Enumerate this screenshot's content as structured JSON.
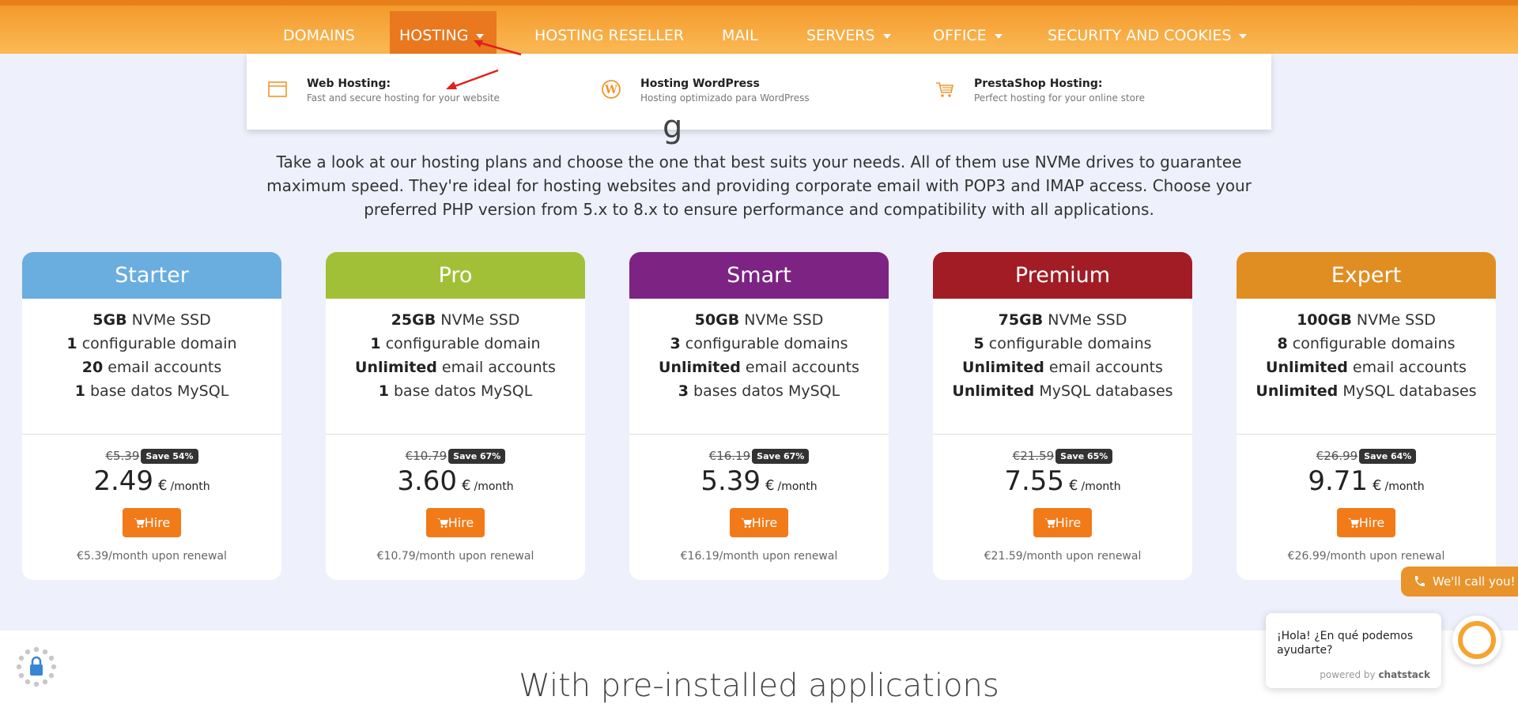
{
  "nav": {
    "items": [
      {
        "label": "DOMAINS"
      },
      {
        "label": "HOSTING"
      },
      {
        "label": "HOSTING RESELLER"
      },
      {
        "label": "MAIL"
      },
      {
        "label": "SERVERS"
      },
      {
        "label": "OFFICE"
      },
      {
        "label": "SECURITY AND COOKIES"
      }
    ]
  },
  "dropdown": {
    "items": [
      {
        "title": "Web Hosting:",
        "subtitle": "Fast and secure hosting for your website",
        "icon": "browser-window-icon"
      },
      {
        "title": "Hosting WordPress",
        "subtitle": "Hosting optimizado para WordPress",
        "icon": "wordpress-icon"
      },
      {
        "title": "PrestaShop Hosting:",
        "subtitle": "Perfect hosting for your online store",
        "icon": "shopping-cart-icon"
      }
    ]
  },
  "intro": {
    "heading_fragment": "g",
    "text": "Take a look at our hosting plans and choose the one that best suits your needs. All of them use NVMe drives to guarantee maximum speed. They're ideal for hosting websites and providing corporate email with POP3 and IMAP access. Choose your preferred PHP version from 5.x to 8.x to ensure performance and compatibility with all applications."
  },
  "plans": [
    {
      "name": "Starter",
      "color": "#6aaddf",
      "f1b": "5GB",
      "f1": " NVMe SSD",
      "f2b": "1",
      "f2": " configurable domain",
      "f3b": "20",
      "f3": " email accounts",
      "f4b": "1",
      "f4": " base datos MySQL",
      "old_price": "€5.39",
      "save": "Save 54%",
      "price": "2.49",
      "currency": "€",
      "per": "/month",
      "hire": "Hire",
      "renewal": "€5.39/month upon renewal"
    },
    {
      "name": "Pro",
      "color": "#a2c037",
      "f1b": "25GB",
      "f1": " NVMe SSD",
      "f2b": "1",
      "f2": " configurable domain",
      "f3b": "Unlimited",
      "f3": " email accounts",
      "f4b": "1",
      "f4": " base datos MySQL",
      "old_price": "€10.79",
      "save": "Save 67%",
      "price": "3.60",
      "currency": "€",
      "per": "/month",
      "hire": "Hire",
      "renewal": "€10.79/month upon renewal"
    },
    {
      "name": "Smart",
      "color": "#7c2384",
      "f1b": "50GB",
      "f1": " NVMe SSD",
      "f2b": "3",
      "f2": " configurable domains",
      "f3b": "Unlimited",
      "f3": " email accounts",
      "f4b": "3",
      "f4": " bases datos MySQL",
      "old_price": "€16.19",
      "save": "Save 67%",
      "price": "5.39",
      "currency": "€",
      "per": "/month",
      "hire": "Hire",
      "renewal": "€16.19/month upon renewal"
    },
    {
      "name": "Premium",
      "color": "#a11c25",
      "f1b": "75GB",
      "f1": " NVMe SSD",
      "f2b": "5",
      "f2": " configurable domains",
      "f3b": "Unlimited",
      "f3": " email accounts",
      "f4b": "Unlimited",
      "f4": " MySQL databases",
      "old_price": "€21.59",
      "save": "Save 65%",
      "price": "7.55",
      "currency": "€",
      "per": "/month",
      "hire": "Hire",
      "renewal": "€21.59/month upon renewal"
    },
    {
      "name": "Expert",
      "color": "#e08e22",
      "f1b": "100GB",
      "f1": " NVMe SSD",
      "f2b": "8",
      "f2": " configurable domains",
      "f3b": "Unlimited",
      "f3": " email accounts",
      "f4b": "Unlimited",
      "f4": " MySQL databases",
      "old_price": "€26.99",
      "save": "Save 64%",
      "price": "9.71",
      "currency": "€",
      "per": "/month",
      "hire": "Hire",
      "renewal": "€26.99/month upon renewal"
    }
  ],
  "lower": {
    "title": "With pre-installed applications"
  },
  "widgets": {
    "callme": "We'll call you!",
    "chat_message": "¡Hola! ¿En qué podemos ayudarte?",
    "chat_powered": "powered by",
    "chat_brand": "chatstack"
  },
  "colors": {
    "accent": "#f27a18",
    "nav": "#f5a540",
    "nav_active": "#e9781f"
  }
}
